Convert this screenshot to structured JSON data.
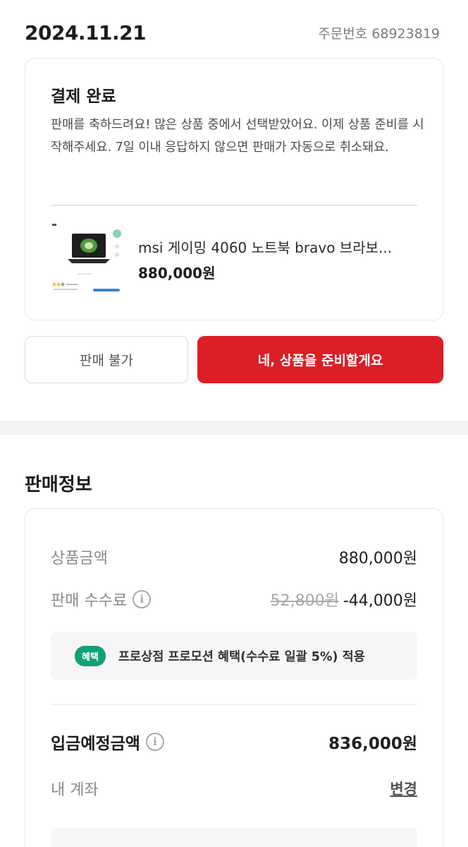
{
  "header": {
    "date": "2024.11.21",
    "order_number": "주문번호 68923819"
  },
  "status": {
    "title": "결제 완료",
    "message": "판매를 축하드려요! 많은 상품 중에서 선택받았어요. 이제 상품 준비를 시작해주세요. 7일 이내 응답하지 않으면 판매가 자동으로 취소돼요."
  },
  "product": {
    "name": "msi 게이밍 4060 노트북 bravo 브라보...",
    "price": "880,000원"
  },
  "actions": {
    "reject_label": "판매 불가",
    "accept_label": "네, 상품을 준비할게요"
  },
  "sales_info": {
    "title": "판매정보",
    "product_amount_label": "상품금액",
    "product_amount": "880,000원",
    "fee_label": "판매 수수료",
    "fee_original": "52,800원",
    "fee_applied": "-44,000원",
    "promo_badge": "혜택",
    "promo_text": "프로상점 프로모션 혜택(수수료 일괄 5%) 적용",
    "deposit_label": "입금예정금액",
    "deposit_amount": "836,000원",
    "account_label": "내 계좌",
    "change_label": "변경"
  },
  "colors": {
    "accent": "#dc1e26",
    "badge": "#12a079"
  }
}
